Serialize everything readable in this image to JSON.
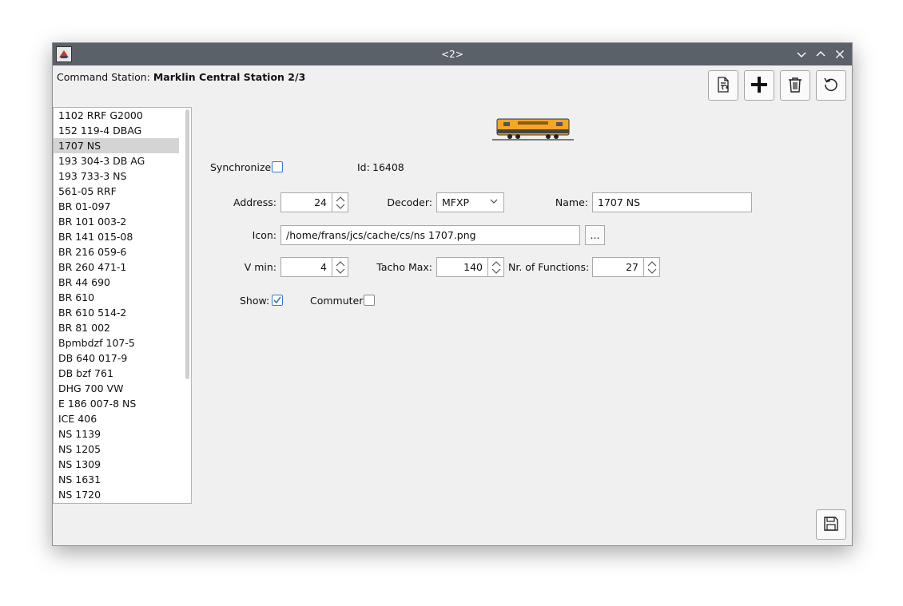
{
  "window": {
    "title": "<2>"
  },
  "header": {
    "command_station_label": "Command Station:",
    "command_station_value": "Marklin Central Station 2/3"
  },
  "locomotives": [
    "1102 RRF G2000",
    "152 119-4 DBAG",
    "1707 NS",
    "193 304-3 DB AG",
    "193 733-3 NS",
    "561-05 RRF",
    "BR 01-097",
    "BR 101 003-2",
    "BR 141 015-08",
    "BR 216 059-6",
    "BR 260 471-1",
    "BR 44 690",
    "BR 610",
    "BR 610 514-2",
    "BR 81 002",
    "Bpmbdzf 107-5",
    "DB 640 017-9",
    "DB bzf 761",
    "DHG 700 VW",
    "E 186 007-8 NS",
    "ICE 406",
    "NS 1139",
    "NS 1205",
    "NS 1309",
    "NS 1631",
    "NS 1720"
  ],
  "selected_index": 2,
  "form": {
    "synchronize_label": "Synchronize:",
    "synchronize_checked": false,
    "id_label": "Id:",
    "id_value": "16408",
    "address_label": "Address:",
    "address_value": "24",
    "decoder_label": "Decoder:",
    "decoder_value": "MFXP",
    "name_label": "Name:",
    "name_value": "1707 NS",
    "icon_label": "Icon:",
    "icon_value": "/home/frans/jcs/cache/cs/ns 1707.png",
    "browse_label": "...",
    "vmin_label": "V min:",
    "vmin_value": "4",
    "tacho_label": "Tacho Max:",
    "tacho_value": "140",
    "functions_label": "Nr. of Functions:",
    "functions_value": "27",
    "show_label": "Show:",
    "show_checked": true,
    "commuter_label": "Commuter:",
    "commuter_checked": false
  },
  "icons": {
    "toolbar": [
      "synchronize-file-icon",
      "add-icon",
      "delete-icon",
      "refresh-icon"
    ],
    "save": "save-icon",
    "window_controls": [
      "minimize-icon",
      "maximize-icon",
      "close-icon"
    ]
  },
  "colors": {
    "titlebar": "#5b6168",
    "loco_body": "#f5a623",
    "check_accent": "#3a78c9",
    "selection": "#d4d4d4"
  }
}
